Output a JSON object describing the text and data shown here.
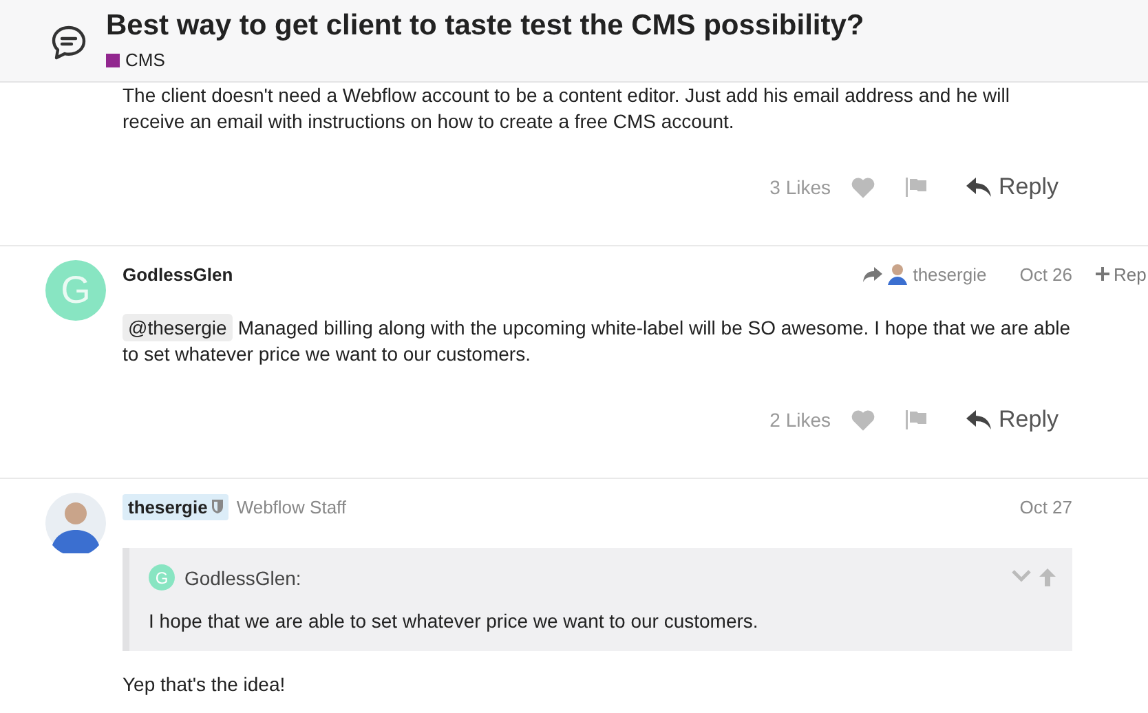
{
  "topic": {
    "title": "Best way to get client to taste test the CMS possibility?",
    "category": {
      "name": "CMS",
      "color": "#92278f"
    }
  },
  "posts": [
    {
      "kind": "continuation",
      "paragraphs": [
        "The client doesn't need a Webflow account to be a content editor. Just add his email address and he will receive an email with instructions on how to create a free CMS account."
      ],
      "likes": "3 Likes",
      "reply": "Reply"
    },
    {
      "kind": "post",
      "author": "GodlessGlen",
      "avatar": {
        "kind": "letter",
        "letter": "G",
        "color": "#88e5c2"
      },
      "reply_to": "thesergie",
      "date": "Oct 26",
      "side_action": "Rep",
      "mention": "@thesergie",
      "body": "Managed billing along with the upcoming white-label will be SO awesome. I hope that we are able to set whatever price we want to our customers.",
      "likes": "2 Likes",
      "reply": "Reply"
    },
    {
      "kind": "post",
      "author": "thesergie",
      "author_highlighted": true,
      "moderator": true,
      "user_title": "Webflow Staff",
      "avatar": {
        "kind": "photo"
      },
      "date": "Oct 27",
      "quote": {
        "author": "GodlessGlen:",
        "letter": "G",
        "color": "#88e5c2",
        "text": "I hope that we are able to set whatever price we want to our customers."
      },
      "body": "Yep that's the idea!"
    }
  ]
}
